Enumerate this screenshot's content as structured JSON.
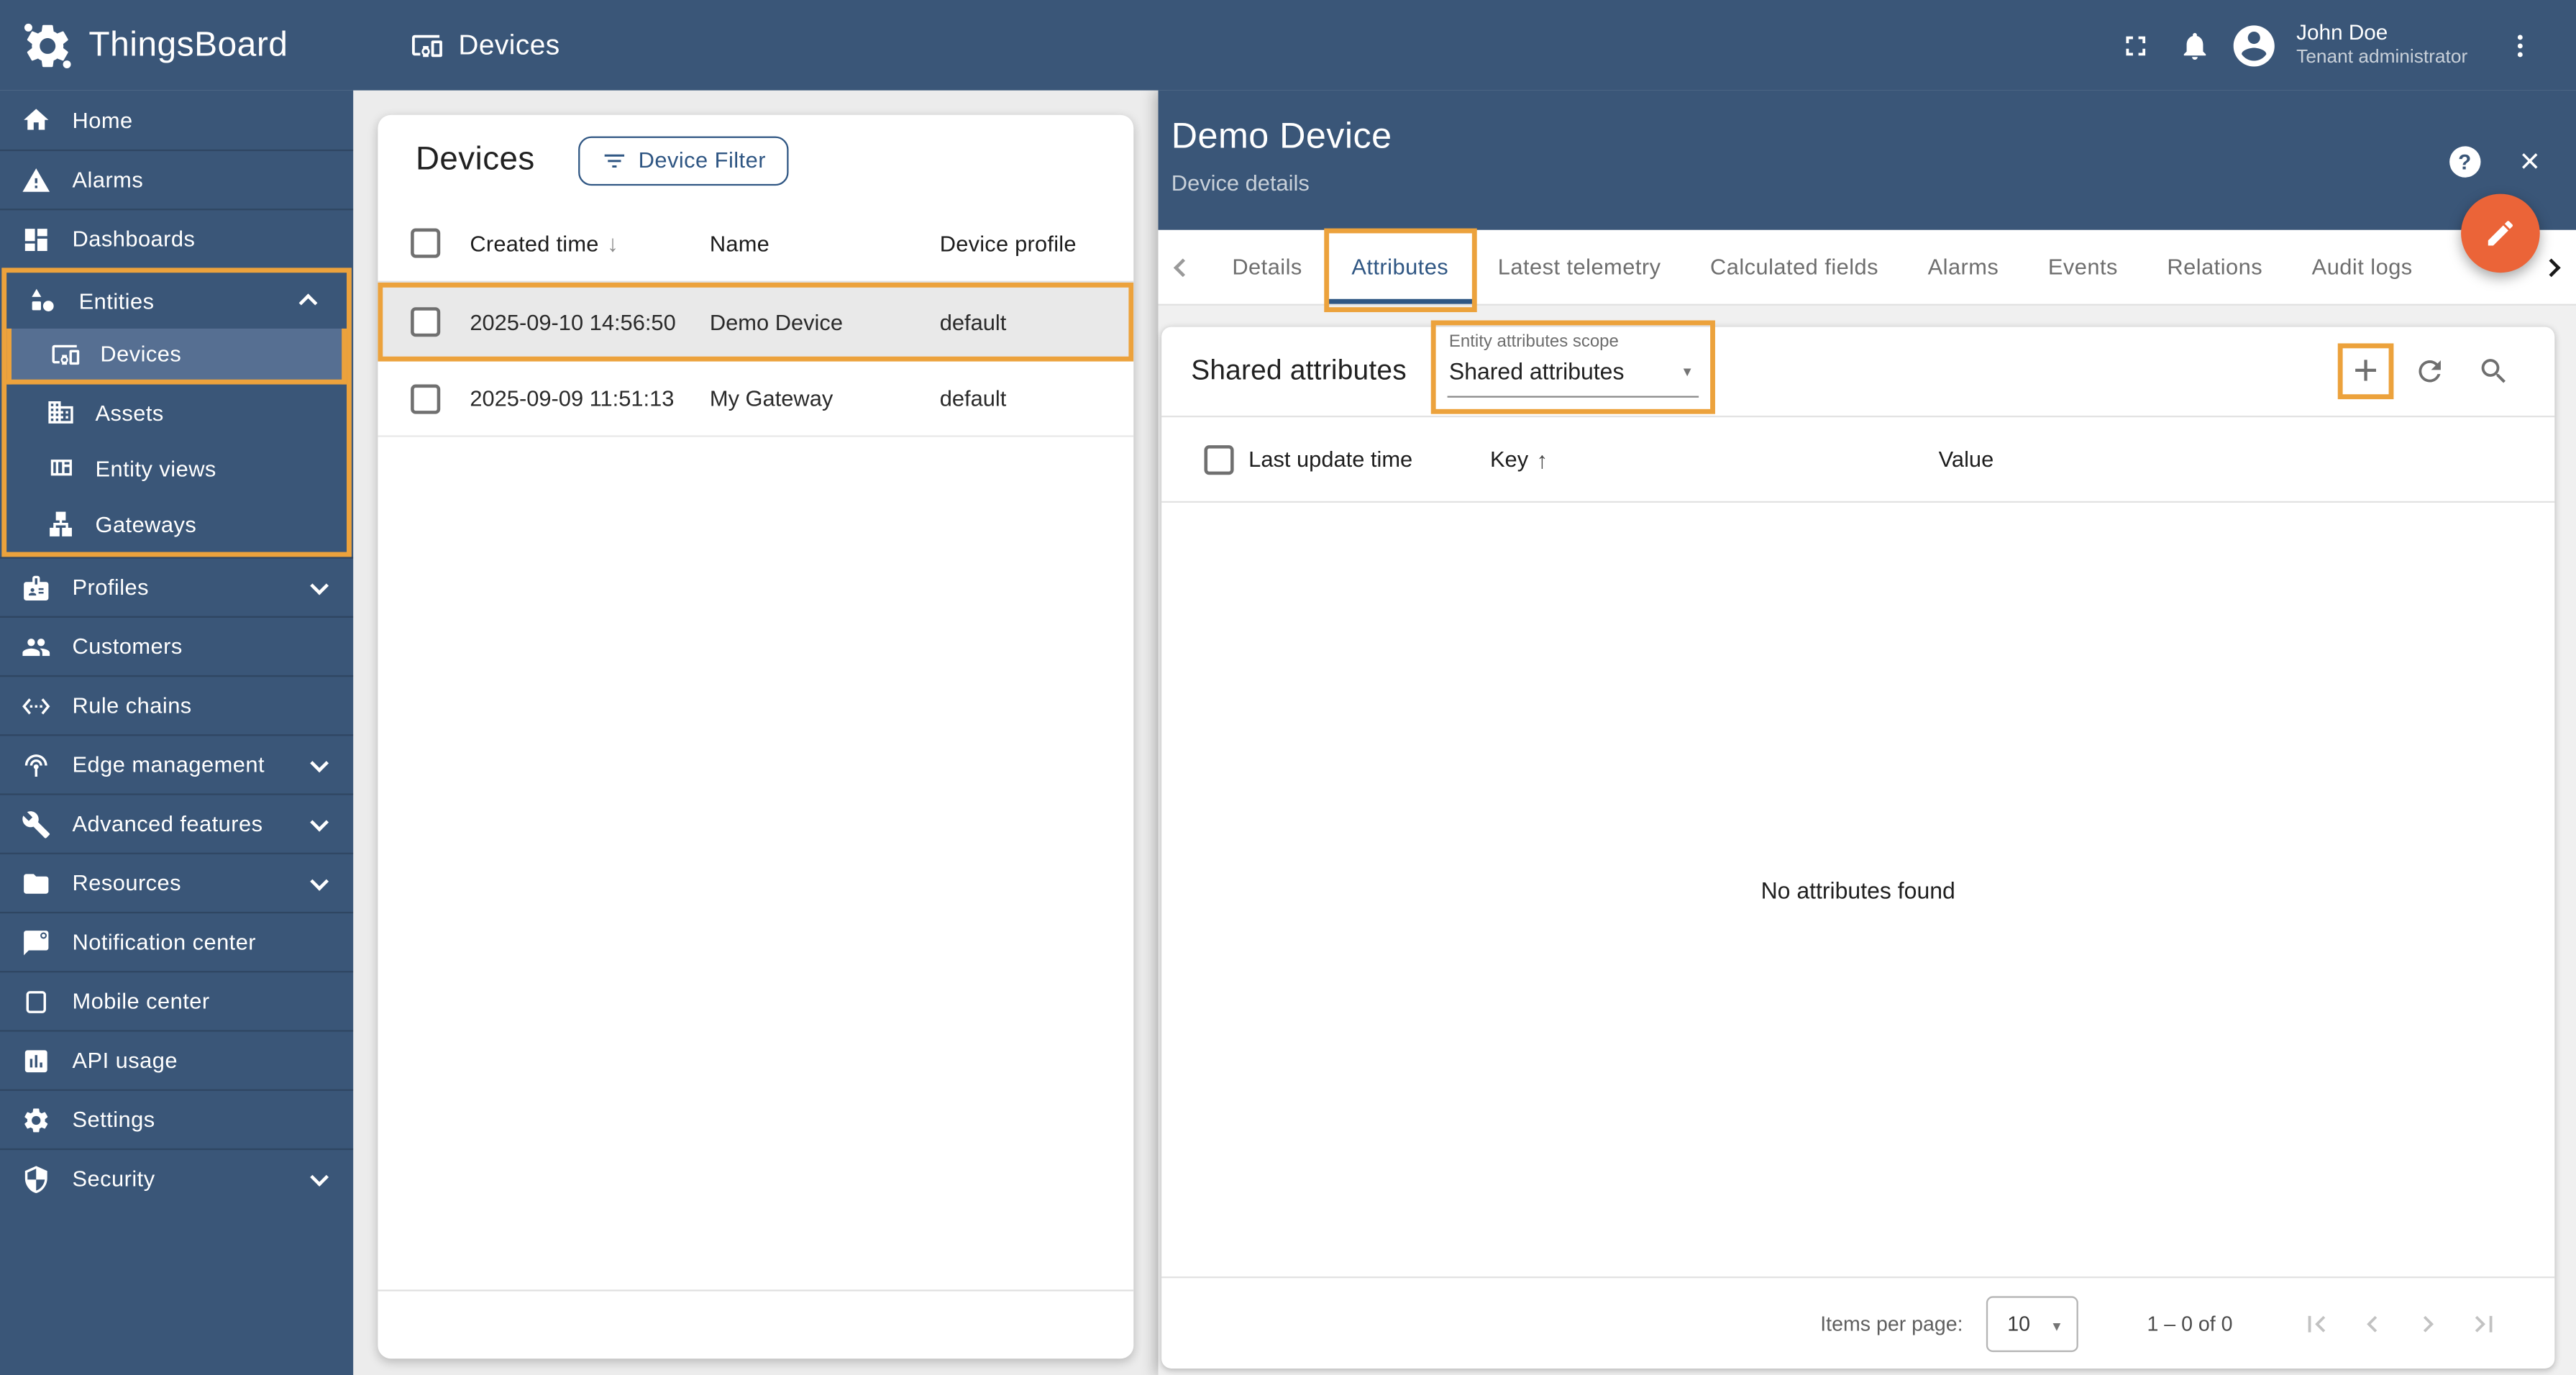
{
  "app": {
    "name": "ThingsBoard"
  },
  "header": {
    "title": "Devices",
    "user_name": "John Doe",
    "user_role": "Tenant administrator"
  },
  "sidebar": {
    "items": [
      {
        "label": "Home"
      },
      {
        "label": "Alarms"
      },
      {
        "label": "Dashboards"
      },
      {
        "label": "Entities"
      },
      {
        "label": "Devices"
      },
      {
        "label": "Assets"
      },
      {
        "label": "Entity views"
      },
      {
        "label": "Gateways"
      },
      {
        "label": "Profiles"
      },
      {
        "label": "Customers"
      },
      {
        "label": "Rule chains"
      },
      {
        "label": "Edge management"
      },
      {
        "label": "Advanced features"
      },
      {
        "label": "Resources"
      },
      {
        "label": "Notification center"
      },
      {
        "label": "Mobile center"
      },
      {
        "label": "API usage"
      },
      {
        "label": "Settings"
      },
      {
        "label": "Security"
      }
    ]
  },
  "devices_panel": {
    "title": "Devices",
    "filter_button": "Device Filter",
    "columns": {
      "created_time": "Created time",
      "name": "Name",
      "device_profile": "Device profile"
    },
    "rows": [
      {
        "created_time": "2025-09-10 14:56:50",
        "name": "Demo Device",
        "profile": "default"
      },
      {
        "created_time": "2025-09-09 11:51:13",
        "name": "My Gateway",
        "profile": "default"
      }
    ]
  },
  "details_panel": {
    "title": "Demo Device",
    "subtitle": "Device details",
    "tabs": {
      "details": "Details",
      "attributes": "Attributes",
      "latest_telemetry": "Latest telemetry",
      "calculated_fields": "Calculated fields",
      "alarms": "Alarms",
      "events": "Events",
      "relations": "Relations",
      "audit_logs": "Audit logs"
    },
    "active_tab": "Attributes",
    "attributes": {
      "title": "Shared attributes",
      "scope_label": "Entity attributes scope",
      "scope_value": "Shared attributes",
      "columns": {
        "last_update_time": "Last update time",
        "key": "Key",
        "value": "Value"
      },
      "empty_text": "No attributes found",
      "pagination": {
        "items_per_page_label": "Items per page:",
        "page_size": "10",
        "range": "1 – 0 of 0"
      }
    }
  },
  "icons": {
    "help": "?",
    "close": "×",
    "plus": "+",
    "sort_desc": "↓",
    "sort_asc": "↑",
    "dropdown": "▼"
  },
  "colors": {
    "primary": "#3A5678",
    "sidebar_selected": "#566F92",
    "annotation_highlight": "#ECA23C",
    "fab": "#EB6438",
    "accent_text": "#2F5683",
    "row_highlight": "#e9e9e9"
  }
}
